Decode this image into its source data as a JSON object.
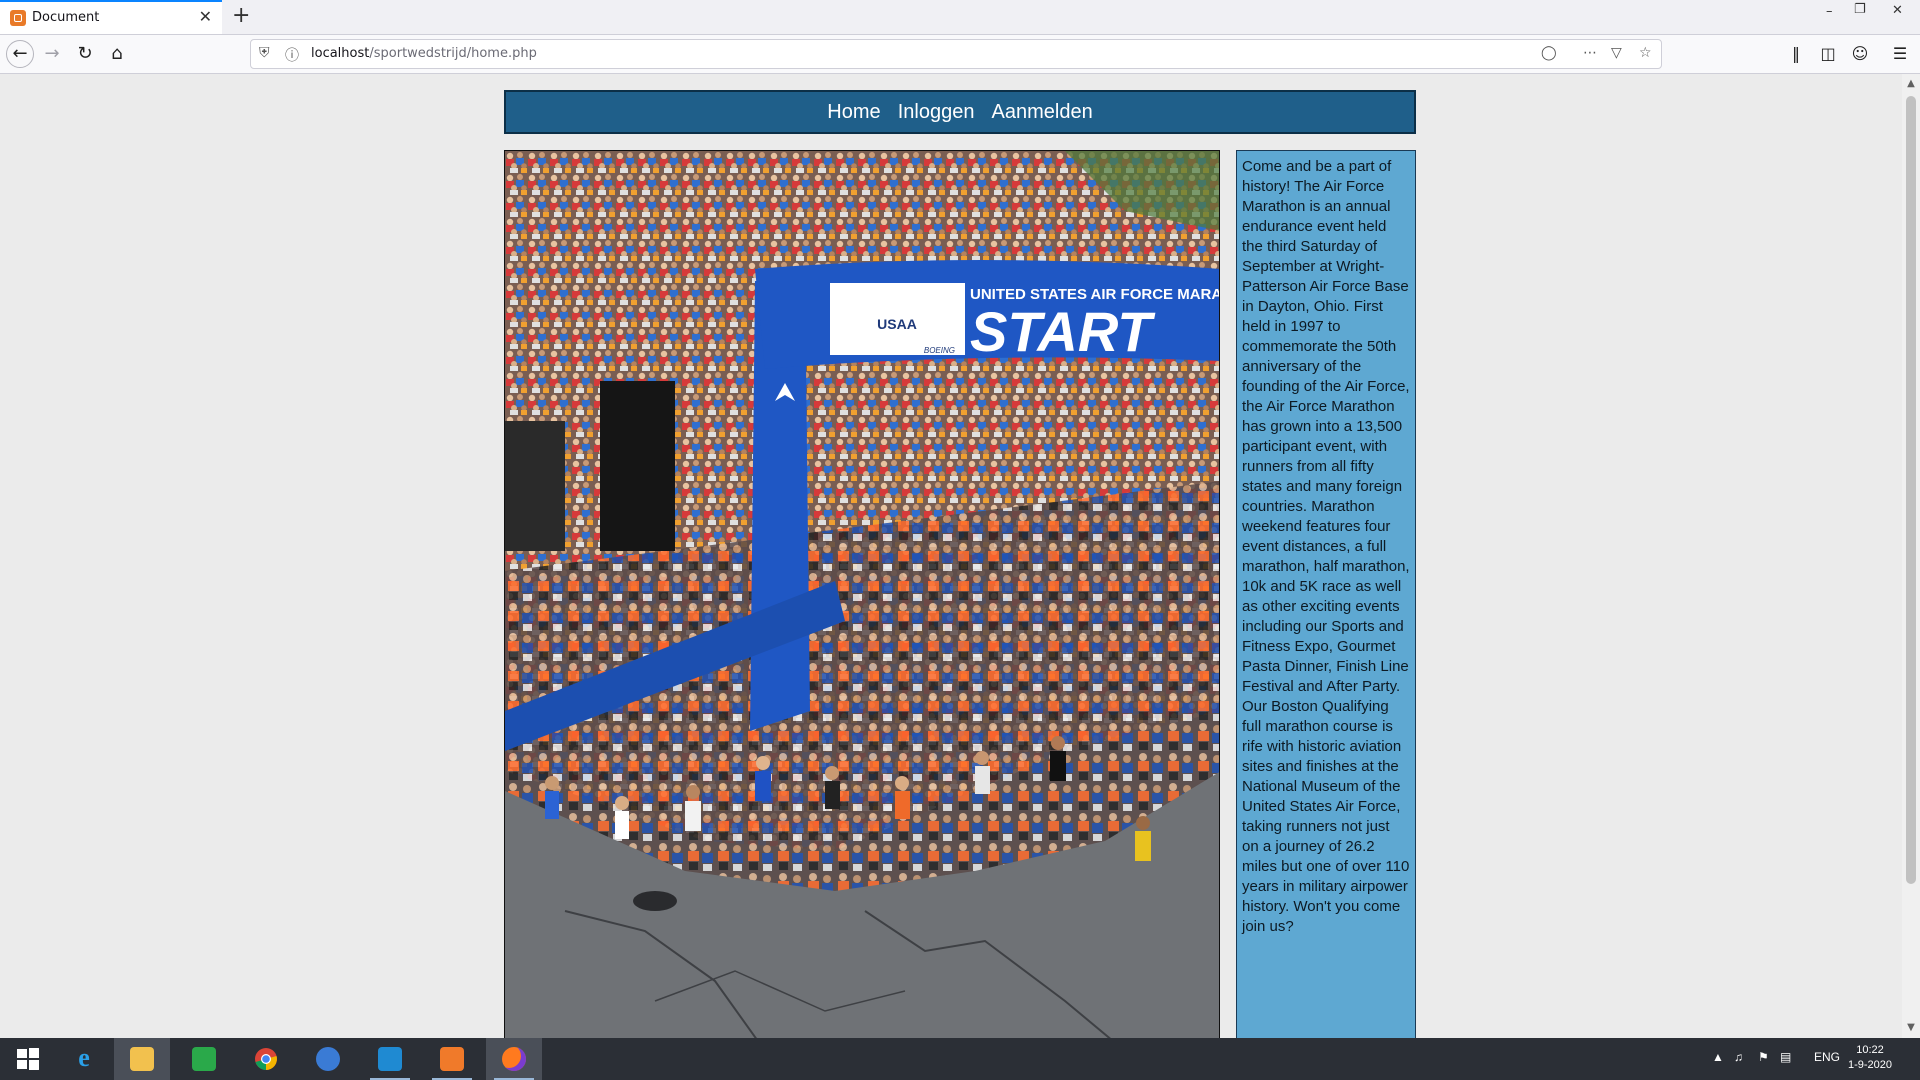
{
  "browser": {
    "tab_title": "Document",
    "tab_close": "✕",
    "new_tab": "+",
    "url_host": "localhost",
    "url_path": "/sportwedstrijd/home.php",
    "window_controls": [
      "–",
      "❐",
      "✕"
    ],
    "icons": [
      "back-icon",
      "forward-icon",
      "reload-icon",
      "home-icon",
      "shield-icon",
      "info-icon",
      "bulb-icon",
      "more-icon",
      "pocket-icon",
      "bookmark-star-icon",
      "library-icon",
      "sidebar-icon",
      "account-icon",
      "menu-icon"
    ]
  },
  "site": {
    "nav": {
      "home": "Home",
      "login": "Inloggen",
      "register": "Aanmelden"
    },
    "hero": {
      "banner_top": "UNITED STATES AIR FORCE MARATHON",
      "banner_main": "START",
      "sponsor1": "USAA",
      "sponsor2": "BOEING"
    },
    "sidebar_text": "Come and be a part of history! The Air Force Marathon is an annual endurance event held the third Saturday of September at Wright-Patterson Air Force Base in Dayton, Ohio. First held in 1997 to commemorate the 50th anniversary of the founding of the Air Force, the Air Force Marathon has grown into a 13,500 participant event, with runners from all fifty states and many foreign countries. Marathon weekend features four event distances, a full marathon, half marathon, 10k and 5K race as well as other exciting events including our Sports and Fitness Expo, Gourmet Pasta Dinner, Finish Line Festival and After Party. Our Boston Qualifying full marathon course is rife with historic aviation sites and finishes at the National Museum of the United States Air Force, taking runners not just on a journey of 26.2 miles but one of over 110 years in military airpower history. Won't you come join us?"
  },
  "taskbar": {
    "apps": [
      "start-icon",
      "internet-explorer-icon",
      "file-explorer-icon",
      "store-icon",
      "chrome-icon",
      "thunderbird-icon",
      "vscode-icon",
      "xampp-icon",
      "firefox-icon"
    ],
    "language": "ENG",
    "time": "10:22",
    "date": "1-9-2020"
  },
  "colors": {
    "nav_bg": "#1f5f8a",
    "sidebar_bg": "#5ea8d2",
    "page_bg": "#ebebeb",
    "taskbar_bg": "#2b2f36"
  }
}
